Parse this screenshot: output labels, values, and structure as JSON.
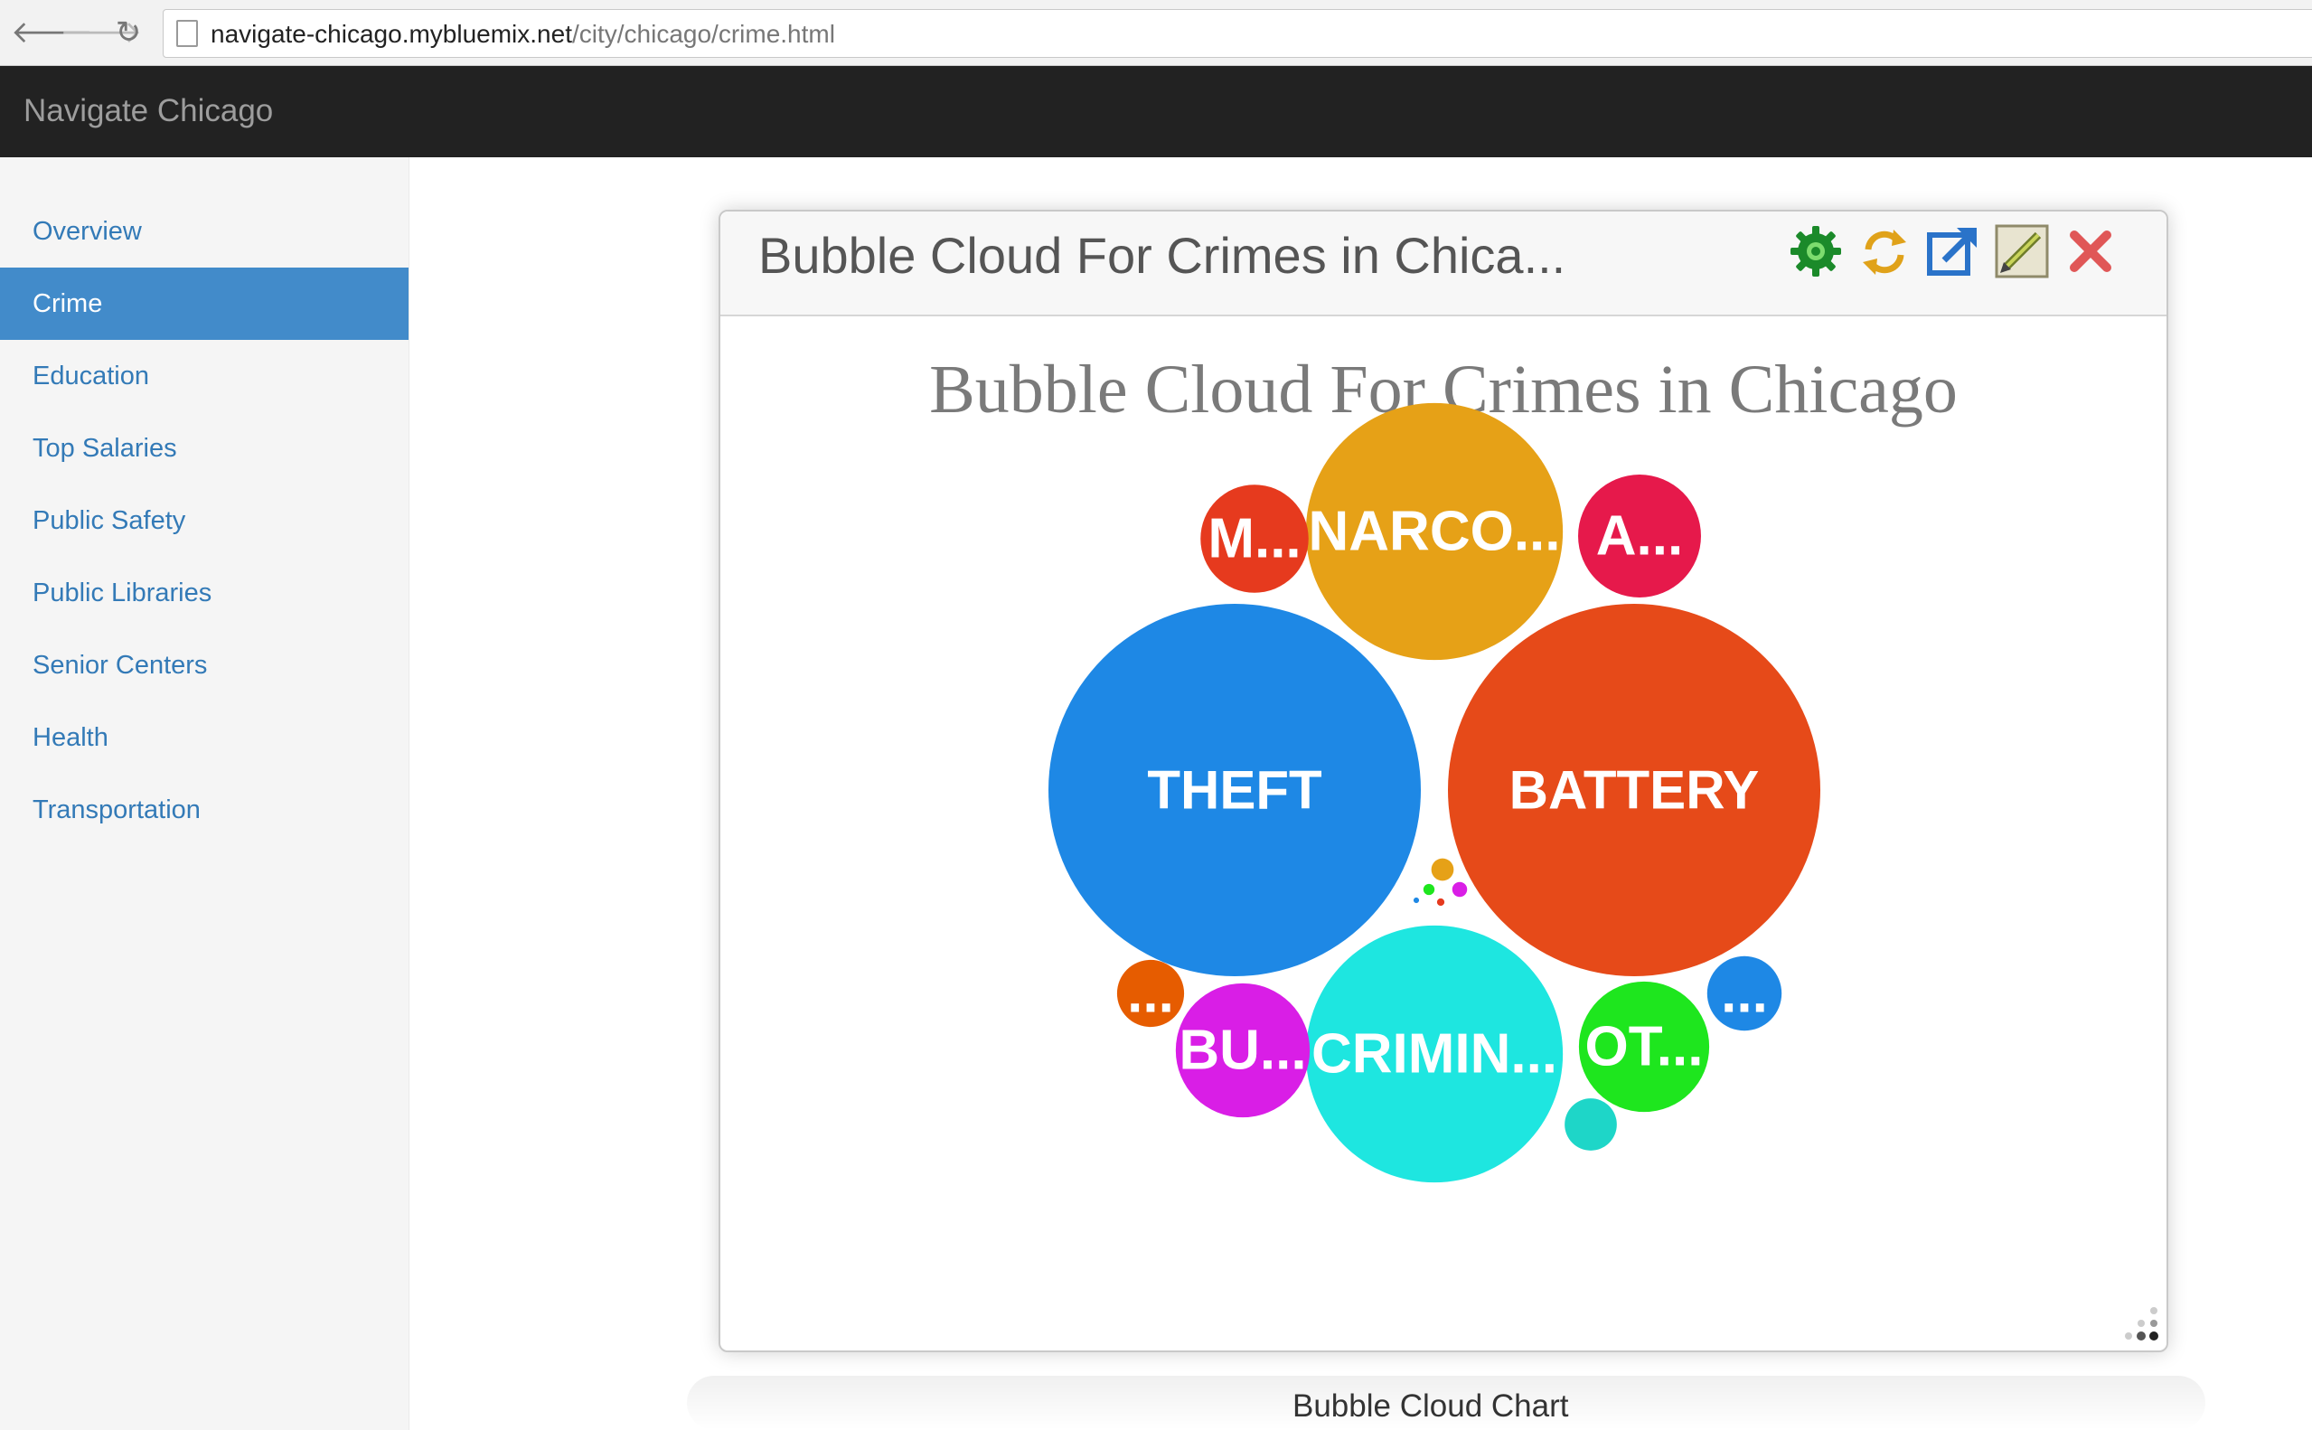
{
  "browser": {
    "url_host": "navigate-chicago.mybluemix.net",
    "url_path": "/city/chicago/crime.html",
    "back_glyph": "🡐",
    "forward_glyph": "🡒",
    "reload_glyph": "↻"
  },
  "navbar": {
    "brand": "Navigate Chicago"
  },
  "sidebar": {
    "items": [
      {
        "label": "Overview",
        "active": false
      },
      {
        "label": "Crime",
        "active": true
      },
      {
        "label": "Education",
        "active": false
      },
      {
        "label": "Top Salaries",
        "active": false
      },
      {
        "label": "Public Safety",
        "active": false
      },
      {
        "label": "Public Libraries",
        "active": false
      },
      {
        "label": "Senior Centers",
        "active": false
      },
      {
        "label": "Health",
        "active": false
      },
      {
        "label": "Transportation",
        "active": false
      }
    ]
  },
  "widget": {
    "title": "Bubble Cloud For Crimes in Chica...",
    "tools": [
      "gear-icon",
      "refresh-icon",
      "open-external-icon",
      "edit-icon",
      "close-icon"
    ]
  },
  "chart_data": {
    "type": "bubble",
    "title": "Bubble Cloud For Crimes in Chicago",
    "bubbles": [
      {
        "label": "BATTERY",
        "color": "#e64a19",
        "size": 1.0
      },
      {
        "label": "THEFT",
        "color": "#1e88e5",
        "size": 1.0
      },
      {
        "label": "NARCO...",
        "color": "#e6a117",
        "size": 0.69
      },
      {
        "label": "CRIMIN...",
        "color": "#1ee6e0",
        "size": 0.69
      },
      {
        "label": "BU...",
        "color": "#d91ee6",
        "size": 0.36
      },
      {
        "label": "OT...",
        "color": "#1ee61e",
        "size": 0.35
      },
      {
        "label": "M...",
        "color": "#e63a1e",
        "size": 0.29
      },
      {
        "label": "A...",
        "color": "#e6194b",
        "size": 0.33
      },
      {
        "label": "...",
        "color": "#1e88e5",
        "size": 0.2
      },
      {
        "label": "...",
        "color": "#e65c00",
        "size": 0.18
      },
      {
        "label": "",
        "color": "#1ed6c8",
        "size": 0.14
      },
      {
        "label": "",
        "color": "#e6a117",
        "size": 0.06
      },
      {
        "label": "",
        "color": "#d91ee6",
        "size": 0.04
      },
      {
        "label": "",
        "color": "#1ee61e",
        "size": 0.03
      },
      {
        "label": "",
        "color": "#e63a1e",
        "size": 0.02
      },
      {
        "label": "",
        "color": "#1e88e5",
        "size": 0.015
      }
    ]
  },
  "caption": "Bubble Cloud Chart"
}
